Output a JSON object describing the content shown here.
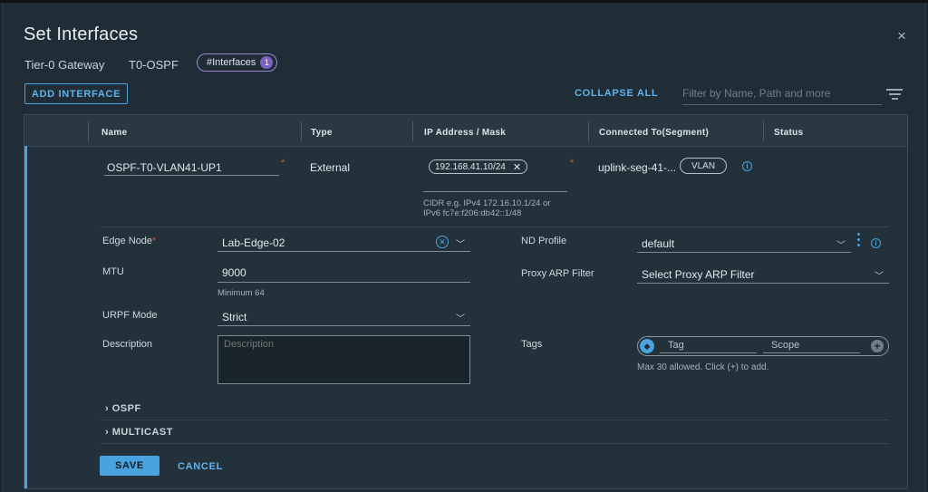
{
  "dialog": {
    "title": "Set Interfaces",
    "close_symbol": "×",
    "gateway_type": "Tier-0 Gateway",
    "gateway_name": "T0-OSPF",
    "interfaces_badge_label": "#Interfaces",
    "interfaces_badge_count": "1"
  },
  "toolbar": {
    "add_interface_label": "ADD INTERFACE",
    "collapse_all_label": "COLLAPSE ALL",
    "filter_placeholder": "Filter by Name, Path and more"
  },
  "grid": {
    "columns": [
      "Name",
      "Type",
      "IP Address / Mask",
      "Connected To(Segment)",
      "Status"
    ]
  },
  "row": {
    "name_value": "OSPF-T0-VLAN41-UP1",
    "required_mark": "*",
    "type_value": "External",
    "ip_chip": "192.168.41.10/24",
    "ip_help_line1": "CIDR e.g. IPv4 172.16.10.1/24 or",
    "ip_help_line2": "IPv6 fc7e:f206:db42::1/48",
    "segment_value": "uplink-seg-41-...",
    "segment_badge": "VLAN"
  },
  "form": {
    "edge_node_label": "Edge Node",
    "edge_node_value": "Lab-Edge-02",
    "mtu_label": "MTU",
    "mtu_value": "9000",
    "mtu_help": "Minimum 64",
    "urpf_label": "URPF Mode",
    "urpf_value": "Strict",
    "description_label": "Description",
    "description_placeholder": "Description",
    "nd_profile_label": "ND Profile",
    "nd_profile_value": "default",
    "proxy_arp_label": "Proxy ARP Filter",
    "proxy_arp_value": "Select Proxy ARP Filter",
    "tags_label": "Tags",
    "tag_placeholder": "Tag",
    "scope_placeholder": "Scope",
    "tags_help": "Max 30 allowed. Click (+) to add.",
    "ospf_label": "OSPF",
    "multicast_label": "MULTICAST",
    "save_label": "SAVE",
    "cancel_label": "CANCEL"
  },
  "colors": {
    "accent": "#4aa3df",
    "badge_purple": "#7a61c4",
    "required_red": "#d2544c",
    "background": "#202d36"
  },
  "icons": {
    "close": "close-icon",
    "filter": "filter-lines-icon",
    "chip_remove": "x-icon",
    "info": "info-icon",
    "clear": "clear-circle-icon",
    "chevron": "chevron-down-icon",
    "kebab": "vertical-ellipsis-icon",
    "tag": "tag-icon",
    "add": "plus-circle-icon",
    "expand": "chevron-right-icon"
  }
}
